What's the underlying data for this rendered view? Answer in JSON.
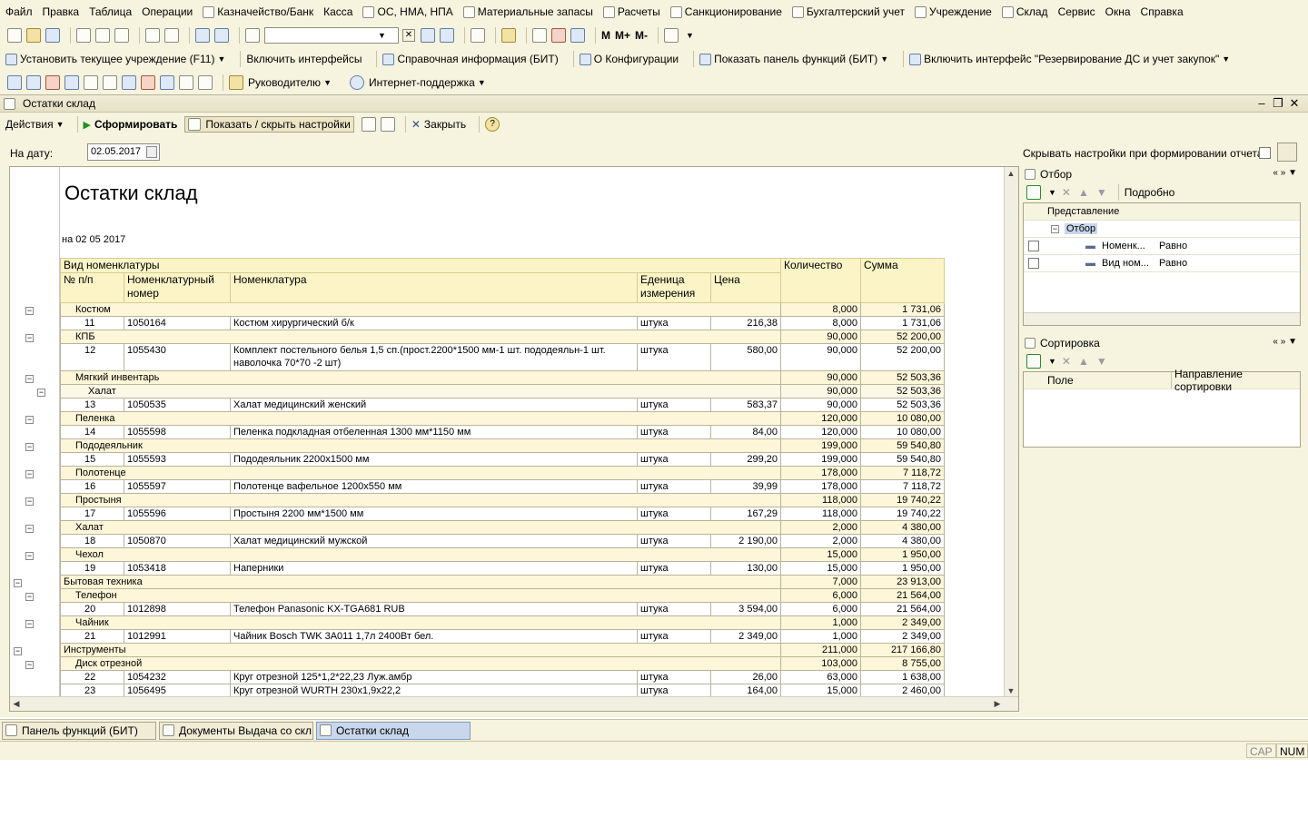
{
  "menu": [
    "Файл",
    "Правка",
    "Таблица",
    "Операции",
    "Казначейство/Банк",
    "Касса",
    "ОС, НМА, НПА",
    "Материальные запасы",
    "Расчеты",
    "Санкционирование",
    "Бухгалтерский учет",
    "Учреждение",
    "Склад",
    "Сервис",
    "Окна",
    "Справка"
  ],
  "toolbar2": [
    "Установить текущее учреждение (F11)",
    "Включить интерфейсы",
    "Справочная информация (БИТ)",
    "О Конфигурации",
    "Показать панель функций (БИТ)",
    "Включить интерфейс \"Резервирование ДС и учет закупок\""
  ],
  "toolbar3": {
    "manager": "Руководителю",
    "support": "Интернет-поддержка"
  },
  "toolbar1": {
    "m1": "М",
    "m2": "М+",
    "m3": "М-",
    "search_value": ""
  },
  "window": {
    "title": "Остатки склад"
  },
  "actions": {
    "actions": "Действия",
    "generate": "Сформировать",
    "toggle": "Показать / скрыть настройки",
    "close": "Закрыть"
  },
  "params": {
    "date_label": "На дату:",
    "date_value": "02.05.2017",
    "hide_label": "Скрывать настройки при формировании отчета"
  },
  "report": {
    "title": "Остатки склад",
    "date": "на 02 05 2017",
    "headers": {
      "kind": "Вид номенклатуры",
      "num": "№ п/п",
      "code": "Номенклатурный номер",
      "name": "Номенклатура",
      "unit": "Еденица измерения",
      "price": "Цена",
      "qty": "Количество",
      "sum": "Сумма"
    },
    "rows": [
      {
        "t": "g",
        "lvl": 1,
        "label": "Костюм",
        "qty": "8,000",
        "sum": "1 731,06"
      },
      {
        "t": "i",
        "num": "11",
        "code": "1050164",
        "name": "Костюм хирургический б/к",
        "unit": "штука",
        "price": "216,38",
        "qty": "8,000",
        "sum": "1 731,06"
      },
      {
        "t": "g",
        "lvl": 1,
        "label": "КПБ",
        "qty": "90,000",
        "sum": "52 200,00"
      },
      {
        "t": "i",
        "tall": true,
        "num": "12",
        "code": "1055430",
        "name": "Комплект постельного белья 1,5 сп.(прост.2200*1500 мм-1 шт. пододеяльн-1 шт. наволочка 70*70 -2 шт)",
        "unit": "штука",
        "price": "580,00",
        "qty": "90,000",
        "sum": "52 200,00"
      },
      {
        "t": "g",
        "lvl": 1,
        "label": "Мягкий инвентарь",
        "qty": "90,000",
        "sum": "52 503,36"
      },
      {
        "t": "g",
        "lvl": 2,
        "label": "Халат",
        "qty": "90,000",
        "sum": "52 503,36"
      },
      {
        "t": "i",
        "num": "13",
        "code": "1050535",
        "name": "Халат медицинский женский",
        "unit": "штука",
        "price": "583,37",
        "qty": "90,000",
        "sum": "52 503,36"
      },
      {
        "t": "g",
        "lvl": 1,
        "label": "Пеленка",
        "qty": "120,000",
        "sum": "10 080,00"
      },
      {
        "t": "i",
        "num": "14",
        "code": "1055598",
        "name": "Пеленка подкладная отбеленная 1300 мм*1150 мм",
        "unit": "штука",
        "price": "84,00",
        "qty": "120,000",
        "sum": "10 080,00"
      },
      {
        "t": "g",
        "lvl": 1,
        "label": "Пододеяльник",
        "qty": "199,000",
        "sum": "59 540,80"
      },
      {
        "t": "i",
        "num": "15",
        "code": "1055593",
        "name": "Пододеяльник 2200х1500 мм",
        "unit": "штука",
        "price": "299,20",
        "qty": "199,000",
        "sum": "59 540,80"
      },
      {
        "t": "g",
        "lvl": 1,
        "label": "Полотенце",
        "qty": "178,000",
        "sum": "7 118,72"
      },
      {
        "t": "i",
        "num": "16",
        "code": "1055597",
        "name": "Полотенце вафельное 1200х550 мм",
        "unit": "штука",
        "price": "39,99",
        "qty": "178,000",
        "sum": "7 118,72"
      },
      {
        "t": "g",
        "lvl": 1,
        "label": "Простыня",
        "qty": "118,000",
        "sum": "19 740,22"
      },
      {
        "t": "i",
        "num": "17",
        "code": "1055596",
        "name": "Простыня 2200 мм*1500 мм",
        "unit": "штука",
        "price": "167,29",
        "qty": "118,000",
        "sum": "19 740,22"
      },
      {
        "t": "g",
        "lvl": 1,
        "label": "Халат",
        "qty": "2,000",
        "sum": "4 380,00"
      },
      {
        "t": "i",
        "num": "18",
        "code": "1050870",
        "name": "Халат медицинский мужской",
        "unit": "штука",
        "price": "2 190,00",
        "qty": "2,000",
        "sum": "4 380,00"
      },
      {
        "t": "g",
        "lvl": 1,
        "label": "Чехол",
        "qty": "15,000",
        "sum": "1 950,00"
      },
      {
        "t": "i",
        "num": "19",
        "code": "1053418",
        "name": "Наперники",
        "unit": "штука",
        "price": "130,00",
        "qty": "15,000",
        "sum": "1 950,00"
      },
      {
        "t": "g",
        "lvl": 0,
        "label": "Бытовая техника",
        "qty": "7,000",
        "sum": "23 913,00"
      },
      {
        "t": "g",
        "lvl": 1,
        "label": "Телефон",
        "qty": "6,000",
        "sum": "21 564,00"
      },
      {
        "t": "i",
        "num": "20",
        "code": "1012898",
        "name": "Телефон Panasonic KX-TGA681 RUB",
        "unit": "штука",
        "price": "3 594,00",
        "qty": "6,000",
        "sum": "21 564,00"
      },
      {
        "t": "g",
        "lvl": 1,
        "label": "Чайник",
        "qty": "1,000",
        "sum": "2 349,00"
      },
      {
        "t": "i",
        "num": "21",
        "code": "1012991",
        "name": "Чайник Bosch TWK 3A011 1,7л 2400Вт бел.",
        "unit": "штука",
        "price": "2 349,00",
        "qty": "1,000",
        "sum": "2 349,00"
      },
      {
        "t": "g",
        "lvl": 0,
        "label": "Инструменты",
        "qty": "211,000",
        "sum": "217 166,80"
      },
      {
        "t": "g",
        "lvl": 1,
        "label": "Диск отрезной",
        "qty": "103,000",
        "sum": "8 755,00"
      },
      {
        "t": "i",
        "num": "22",
        "code": "1054232",
        "name": "Круг отрезной 125*1,2*22,23 Луж.амбр",
        "unit": "штука",
        "price": "26,00",
        "qty": "63,000",
        "sum": "1 638,00"
      },
      {
        "t": "i",
        "num": "23",
        "code": "1056495",
        "name": "Круг отрезной WURTH 230х1,9х22,2",
        "unit": "штука",
        "price": "164,00",
        "qty": "15,000",
        "sum": "2 460,00"
      }
    ]
  },
  "filter": {
    "title": "Отбор",
    "details": "Подробно",
    "col": "Представление",
    "root": "Отбор",
    "rows": [
      {
        "field": "Номенк...",
        "cond": "Равно"
      },
      {
        "field": "Вид ном...",
        "cond": "Равно"
      }
    ]
  },
  "sort": {
    "title": "Сортировка",
    "col_field": "Поле",
    "col_dir": "Направление сортировки"
  },
  "tasks": [
    "Панель функций (БИТ)",
    "Документы Выдача со скл...",
    "Остатки склад"
  ],
  "status": {
    "cap": "CAP",
    "num": "NUM"
  }
}
